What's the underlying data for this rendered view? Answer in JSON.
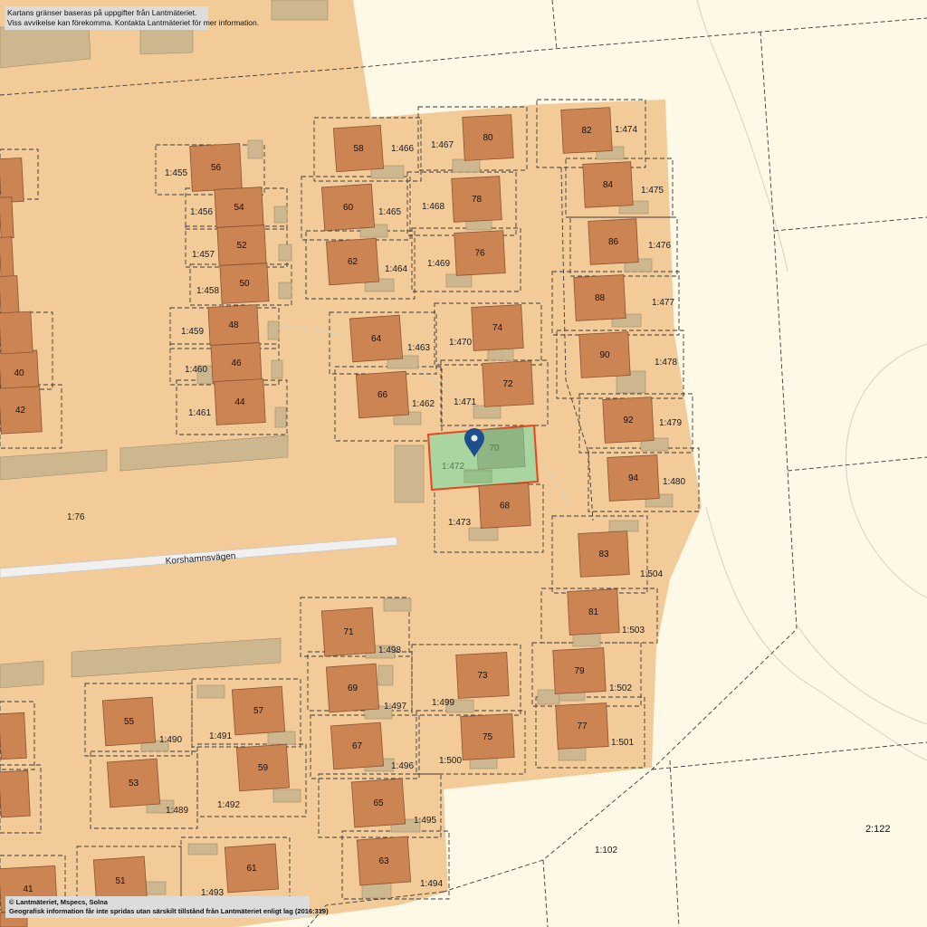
{
  "notices": {
    "top": [
      "Kartans gränser baseras på uppgifter från Lantmäteriet.",
      "Viss avvikelse kan förekomma. Kontakta Lantmäteriet för mer information."
    ],
    "bottom": [
      "© Lantmäteriet, Mspecs, Solna",
      "Geografisk information får inte spridas utan särskilt tillstånd från Lantmäteriet enligt lag (2016:319)"
    ]
  },
  "road_name": "Korshamnsvägen",
  "colors": {
    "background": "#fdf9e6",
    "residential": "#f2cb99",
    "building": "#cc8452",
    "building_stroke": "#8a5332",
    "outbuilding": "#cdb78f",
    "selected_fill": "#a8d5a0",
    "selected_stroke": "#e8461f",
    "pin": "#1d4f8c"
  },
  "selected_parcel": {
    "label": "1:472",
    "house_number": "70"
  },
  "parcel_labels": [
    "1:466",
    "1:467",
    "1:474",
    "1:455",
    "1:456",
    "1:457",
    "1:458",
    "1:459",
    "1:460",
    "1:461",
    "1:465",
    "1:468",
    "1:475",
    "1:464",
    "1:469",
    "1:476",
    "1:477",
    "1:463",
    "1:470",
    "1:478",
    "1:462",
    "1:471",
    "1:479",
    "1:480",
    "1:76",
    "1:473",
    "1:504",
    "1:503",
    "1:498",
    "1:502",
    "1:497",
    "1:499",
    "1:490",
    "1:491",
    "1:501",
    "1:496",
    "1:500",
    "1:489",
    "1:492",
    "1:495",
    "1:494",
    "1:102",
    "2:122",
    "1:493"
  ],
  "house_numbers": [
    "58",
    "80",
    "82",
    "56",
    "60",
    "78",
    "84",
    "54",
    "52",
    "62",
    "76",
    "86",
    "50",
    "88",
    "48",
    "64",
    "74",
    "90",
    "46",
    "66",
    "72",
    "92",
    "44",
    "94",
    "68",
    "83",
    "81",
    "71",
    "73",
    "79",
    "69",
    "55",
    "57",
    "77",
    "67",
    "75",
    "53",
    "59",
    "65",
    "63",
    "61",
    "51",
    "41",
    "40",
    "42"
  ]
}
